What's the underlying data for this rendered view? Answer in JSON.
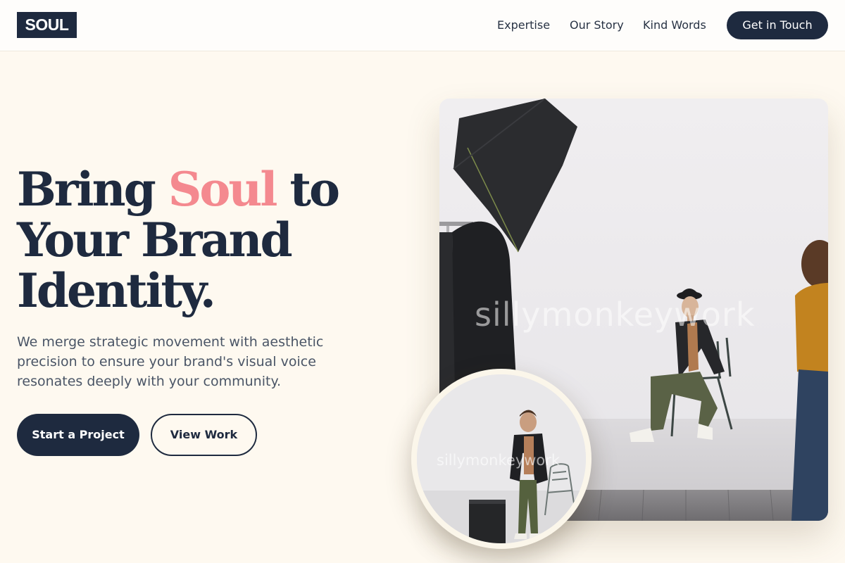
{
  "brand": {
    "logo": "SOUL"
  },
  "nav": {
    "items": [
      {
        "label": "Expertise"
      },
      {
        "label": "Our Story"
      },
      {
        "label": "Kind Words"
      }
    ],
    "cta_label": "Get in Touch"
  },
  "hero": {
    "title_part1": "Bring ",
    "title_accent": "Soul",
    "title_part2": " to Your Brand Identity.",
    "description": "We merge strategic movement with aesthetic precision to ensure your brand's visual voice resonates deeply with your community.",
    "primary_button": "Start a Project",
    "secondary_button": "View Work"
  },
  "media": {
    "main_photo_watermark": "sillymonkeywork",
    "circle_photo_watermark": "sillymonkeywork"
  },
  "colors": {
    "page_background": "#fef9f0",
    "navy": "#1e2a3f",
    "accent_pink": "#f4898f",
    "body_text": "#4a5566"
  }
}
